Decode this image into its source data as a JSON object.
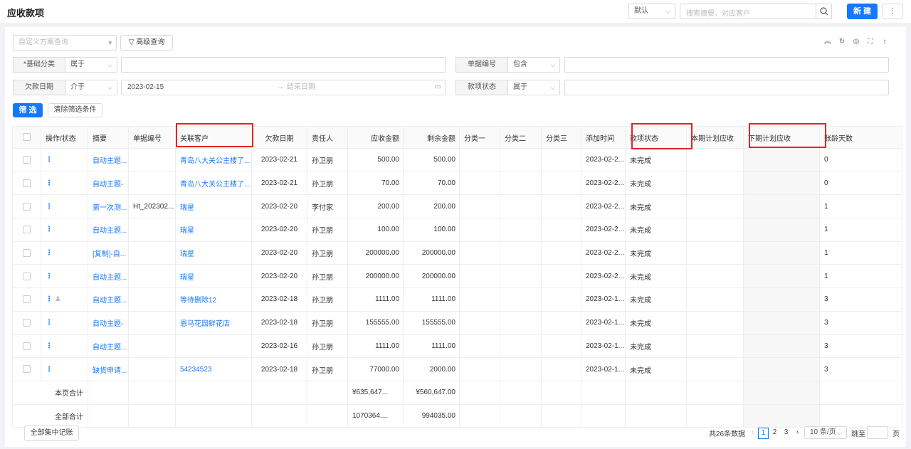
{
  "header": {
    "title": "应收款项",
    "view_select": "默认",
    "search_placeholder": "搜索摘要、对应客户",
    "new_button": "新 建",
    "more_button": "⋮"
  },
  "filters": {
    "scheme_placeholder": "自定义方案查询",
    "advanced_button": "高级查询",
    "row1_label": "*基础分类",
    "row1_op": "属于",
    "row1_right_label": "单据编号",
    "row1_right_op": "包含",
    "row2_label": "欠款日期",
    "row2_op": "介于",
    "date_start": "2023-02-15",
    "date_end_placeholder": "结束日期",
    "row2_right_label": "款项状态",
    "row2_right_op": "属于",
    "apply_button": "筛 选",
    "clear_button": "清除筛选条件"
  },
  "table": {
    "columns": [
      "操作/状态",
      "摘要",
      "单据编号",
      "关联客户",
      "欠款日期",
      "责任人",
      "应收金额",
      "剩余金额",
      "分类一",
      "分类二",
      "分类三",
      "添加时间",
      "款项状态",
      "本期计划应收",
      "下期计划应收",
      "账龄天数"
    ],
    "rows": [
      {
        "summary": "自动主题...",
        "code": "",
        "customer": "青岛八大关公主楼了...",
        "date": "2023-02-21",
        "owner": "孙卫朋",
        "amount": "500.00",
        "remain": "500.00",
        "added": "2023-02-2...",
        "status": "未完成",
        "days": "0"
      },
      {
        "summary": "自动主题-",
        "code": "",
        "customer": "青岛八大关公主楼了...",
        "date": "2023-02-21",
        "owner": "孙卫朋",
        "amount": "70.00",
        "remain": "70.00",
        "added": "2023-02-2...",
        "status": "未完成",
        "days": "0"
      },
      {
        "summary": "第一次测...",
        "code": "Ht_202302...",
        "customer": "瑞星",
        "date": "2023-02-20",
        "owner": "李付家",
        "amount": "200.00",
        "remain": "200.00",
        "added": "2023-02-2...",
        "status": "未完成",
        "days": "1"
      },
      {
        "summary": "自动主题...",
        "code": "",
        "customer": "瑞星",
        "date": "2023-02-20",
        "owner": "孙卫朋",
        "amount": "100.00",
        "remain": "100.00",
        "added": "2023-02-2...",
        "status": "未完成",
        "days": "1"
      },
      {
        "summary": "[复制]-自...",
        "code": "",
        "customer": "瑞星",
        "date": "2023-02-20",
        "owner": "孙卫朋",
        "amount": "200000.00",
        "remain": "200000.00",
        "added": "2023-02-2...",
        "status": "未完成",
        "days": "1"
      },
      {
        "summary": "自动主题...",
        "code": "",
        "customer": "瑞星",
        "date": "2023-02-20",
        "owner": "孙卫朋",
        "amount": "200000.00",
        "remain": "200000.00",
        "added": "2023-02-2...",
        "status": "未完成",
        "days": "1"
      },
      {
        "summary": "自动主题...",
        "code": "",
        "customer": "等待删除12",
        "date": "2023-02-18",
        "owner": "孙卫朋",
        "amount": "1111.00",
        "remain": "1111.00",
        "added": "2023-02-1...",
        "status": "未完成",
        "days": "3"
      },
      {
        "summary": "自动主题-",
        "code": "",
        "customer": "恩马花园鲜花店",
        "date": "2023-02-18",
        "owner": "孙卫朋",
        "amount": "155555.00",
        "remain": "155555.00",
        "added": "2023-02-1...",
        "status": "未完成",
        "days": "3"
      },
      {
        "summary": "自动主题...",
        "code": "",
        "customer": "",
        "date": "2023-02-16",
        "owner": "孙卫朋",
        "amount": "1111.00",
        "remain": "1111.00",
        "added": "2023-02-1...",
        "status": "未完成",
        "days": "3"
      },
      {
        "summary": "缺货申请...",
        "code": "",
        "customer": "54234523",
        "date": "2023-02-18",
        "owner": "孙卫朋",
        "amount": "77000.00",
        "remain": "2000.00",
        "added": "2023-02-1...",
        "status": "未完成",
        "days": "3"
      }
    ],
    "page_total_label": "本页合计",
    "page_total_amount": "¥635,647...",
    "page_total_remain": "¥560,647.00",
    "all_total_label": "全部合计",
    "all_total_amount": "1070364....",
    "all_total_remain": "994035.00"
  },
  "footer": {
    "batch_button": "全部集中记账",
    "total_text": "共26条数据",
    "pages": [
      "1",
      "2",
      "3"
    ],
    "page_size": "10 条/页",
    "goto_label": "跳至",
    "page_suffix": "页"
  },
  "colors": {
    "accent": "#1677ff",
    "highlight": "#e0242a"
  }
}
